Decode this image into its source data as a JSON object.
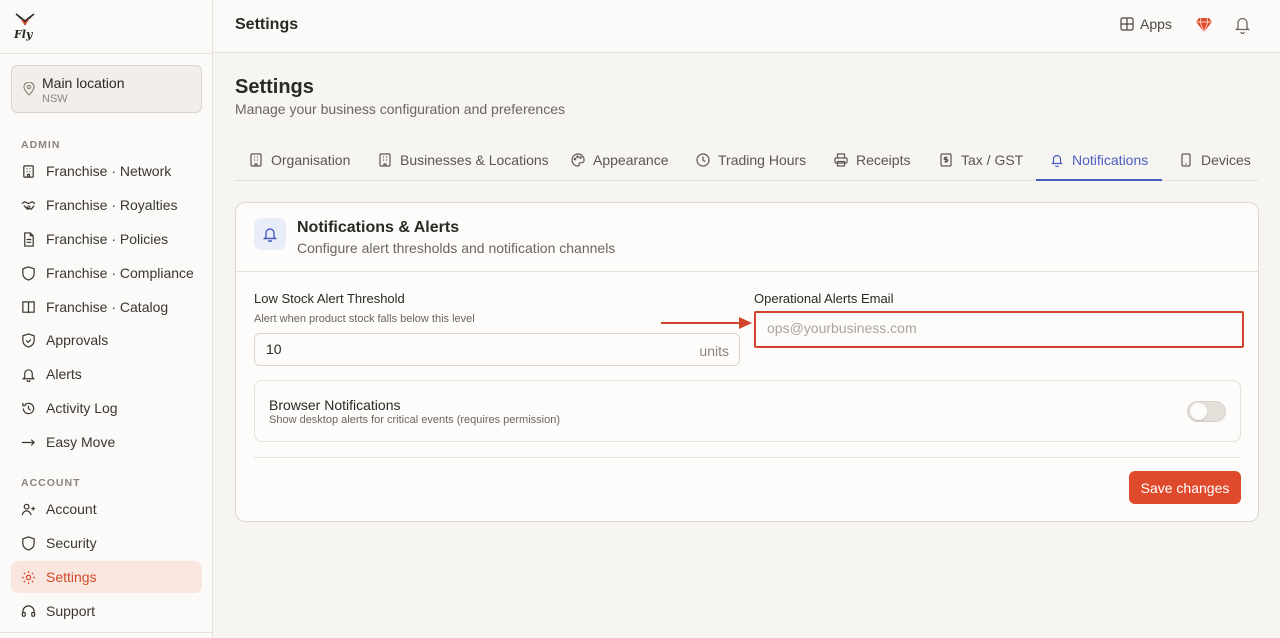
{
  "sidebar": {
    "location": {
      "name": "Main location",
      "sub": "NSW"
    },
    "admin_label": "ADMIN",
    "admin_items": [
      {
        "label": "Franchise · Network",
        "icon": "building-icon"
      },
      {
        "label": "Franchise · Royalties",
        "icon": "handshake-icon"
      },
      {
        "label": "Franchise · Policies",
        "icon": "document-icon"
      },
      {
        "label": "Franchise · Compliance",
        "icon": "shield-icon"
      },
      {
        "label": "Franchise · Catalog",
        "icon": "book-icon"
      },
      {
        "label": "Approvals",
        "icon": "shield-check-icon"
      },
      {
        "label": "Alerts",
        "icon": "bell-icon"
      },
      {
        "label": "Activity Log",
        "icon": "history-icon"
      },
      {
        "label": "Easy Move",
        "icon": "arrow-right-icon"
      }
    ],
    "account_label": "ACCOUNT",
    "account_items": [
      {
        "label": "Account",
        "icon": "user-icon"
      },
      {
        "label": "Security",
        "icon": "shield-icon"
      },
      {
        "label": "Settings",
        "icon": "gear-icon",
        "active": true
      },
      {
        "label": "Support",
        "icon": "headset-icon"
      }
    ]
  },
  "header": {
    "title": "Settings",
    "apps_label": "Apps"
  },
  "page": {
    "title": "Settings",
    "subtitle": "Manage your business configuration and preferences"
  },
  "tabs": [
    {
      "label": "Organisation"
    },
    {
      "label": "Businesses & Locations"
    },
    {
      "label": "Appearance"
    },
    {
      "label": "Trading Hours"
    },
    {
      "label": "Receipts"
    },
    {
      "label": "Tax / GST"
    },
    {
      "label": "Notifications",
      "active": true
    },
    {
      "label": "Devices"
    }
  ],
  "card": {
    "title": "Notifications & Alerts",
    "subtitle": "Configure alert thresholds and notification channels",
    "low_stock": {
      "label": "Low Stock Alert Threshold",
      "help": "Alert when product stock falls below this level",
      "value": "10",
      "suffix": "units"
    },
    "ops_email": {
      "label": "Operational Alerts Email",
      "placeholder": "ops@yourbusiness.com",
      "value": ""
    },
    "browser_notifications": {
      "title": "Browser Notifications",
      "subtitle": "Show desktop alerts for critical events (requires permission)",
      "enabled": false
    },
    "save_label": "Save changes"
  },
  "colors": {
    "accent": "#e04a2c",
    "tab_active": "#4a5fc1",
    "highlight": "#d3452a"
  }
}
